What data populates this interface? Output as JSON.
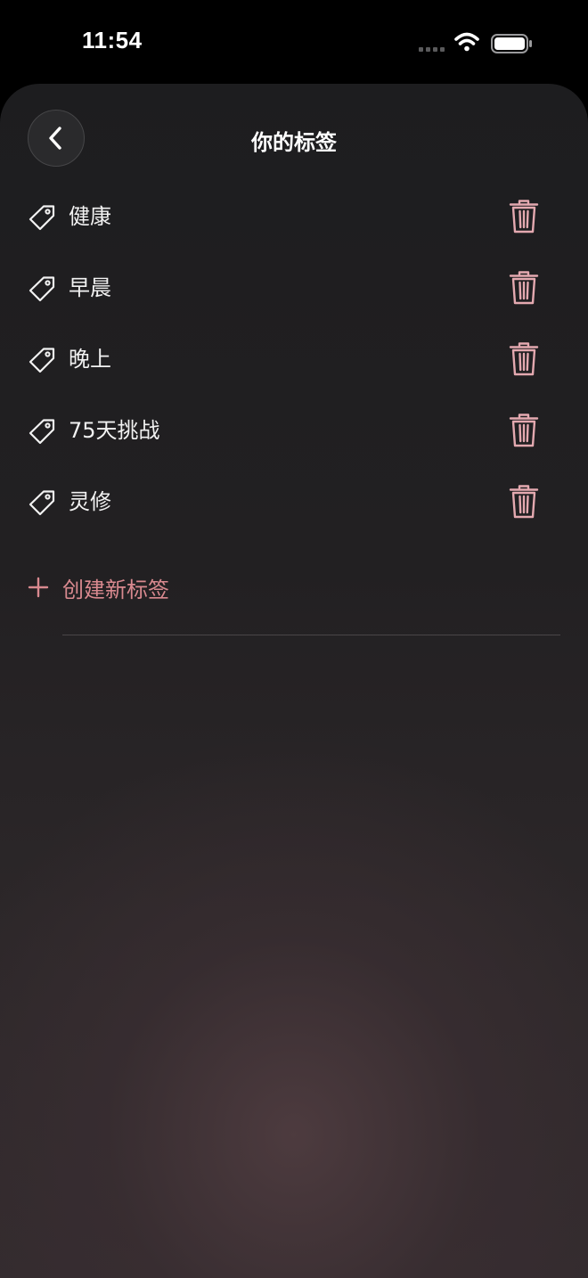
{
  "status_bar": {
    "time": "11:54",
    "icons": [
      "cellular-signal-icon",
      "wifi-icon",
      "battery-icon"
    ]
  },
  "header": {
    "title": "你的标签",
    "back_icon": "chevron-left-icon"
  },
  "tags": [
    {
      "label": "健康"
    },
    {
      "label": "早晨"
    },
    {
      "label": "晚上"
    },
    {
      "label": "75天挑战"
    },
    {
      "label": "灵修"
    }
  ],
  "create_tag": {
    "label": "创建新标签",
    "icon": "plus-icon"
  },
  "colors": {
    "accent": "#d9898f",
    "trash": "#e4a9b0",
    "text": "#f2f2f2",
    "background": "#1d1d1f"
  }
}
